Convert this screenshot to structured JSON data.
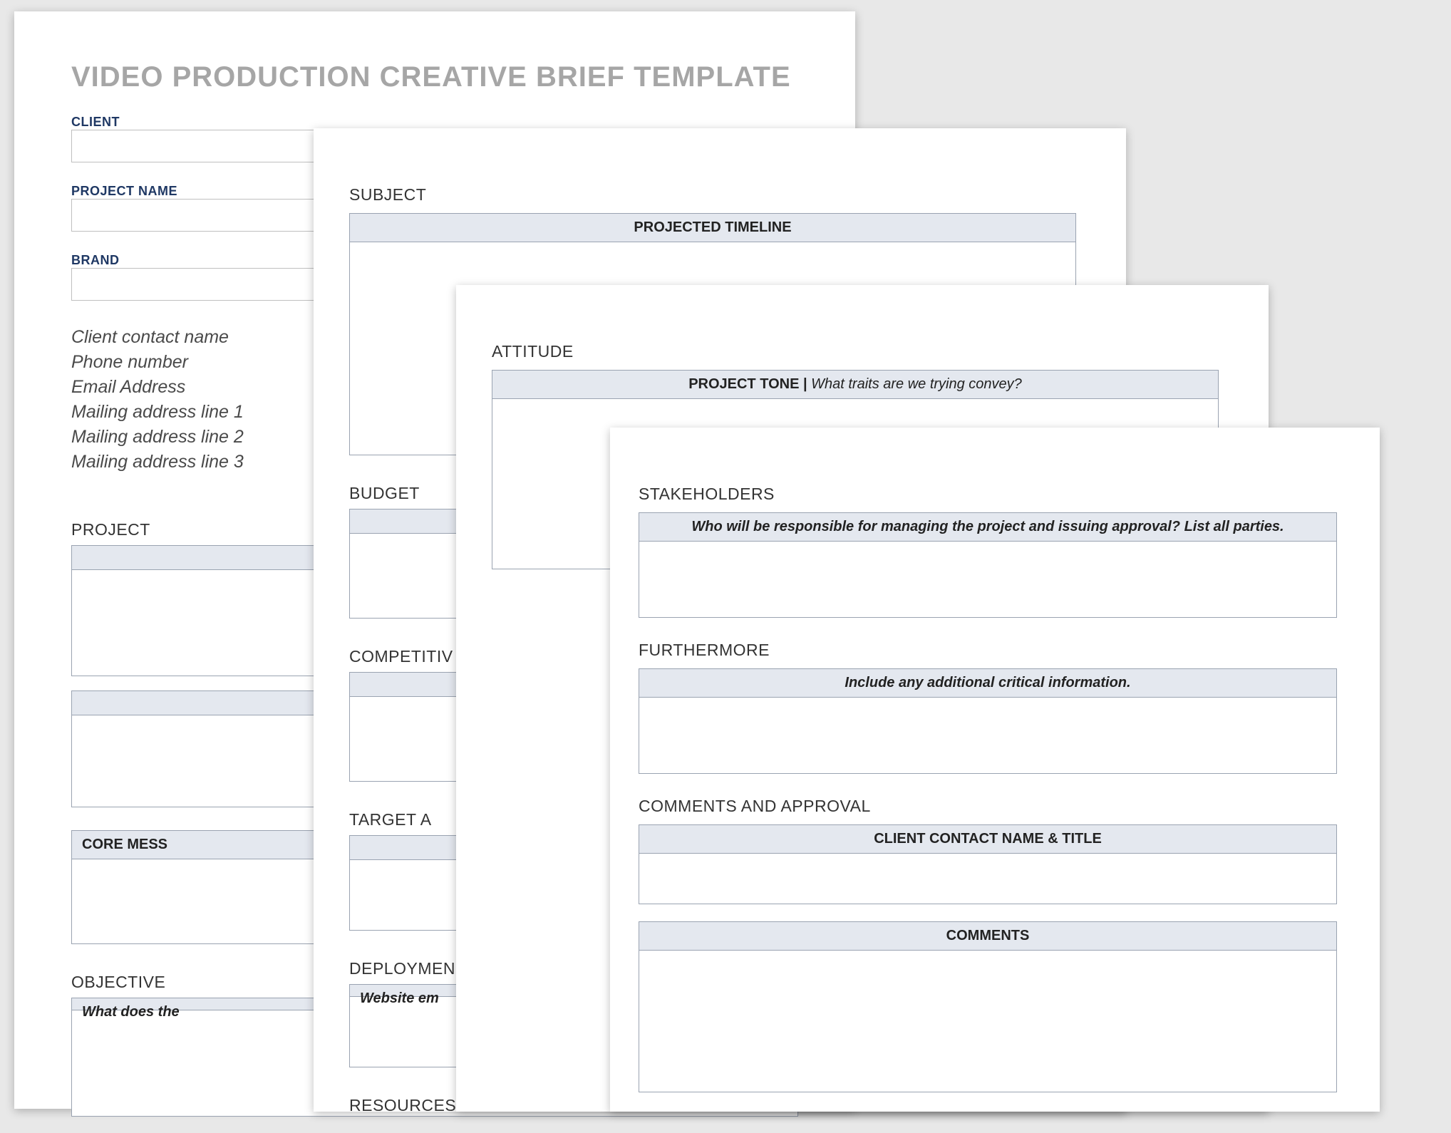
{
  "title": "VIDEO PRODUCTION CREATIVE BRIEF TEMPLATE",
  "page1": {
    "client_label": "CLIENT",
    "project_name_label": "PROJECT NAME",
    "brand_label": "BRAND",
    "contact_lines": [
      "Client contact name",
      "Phone number",
      "Email Address",
      "Mailing address line 1",
      "Mailing address line 2",
      "Mailing address line 3"
    ],
    "project_section": "PROJECT",
    "core_message_band": "CORE MESS",
    "objective_section": "OBJECTIVE",
    "objective_hint": "What does the"
  },
  "page2": {
    "subject_section": "SUBJECT",
    "timeline_band": "PROJECTED TIMELINE",
    "budget_section": "BUDGET",
    "competitive_section": "COMPETITIV",
    "target_section": "TARGET A",
    "deployment_section": "DEPLOYMEN",
    "deployment_hint": "Website em",
    "resources_section": "RESOURCES"
  },
  "page3": {
    "attitude_section": "ATTITUDE",
    "tone_band_bold": "PROJECT TONE   |   ",
    "tone_band_italic": "What traits are we trying convey?"
  },
  "page4": {
    "stakeholders_section": "STAKEHOLDERS",
    "stakeholders_hint": "Who will be responsible for managing the project and issuing approval? List all parties.",
    "furthermore_section": "FURTHERMORE",
    "furthermore_hint": "Include any additional critical information.",
    "comments_section": "COMMENTS AND APPROVAL",
    "contact_band": "CLIENT CONTACT NAME & TITLE",
    "comments_band": "COMMENTS"
  }
}
